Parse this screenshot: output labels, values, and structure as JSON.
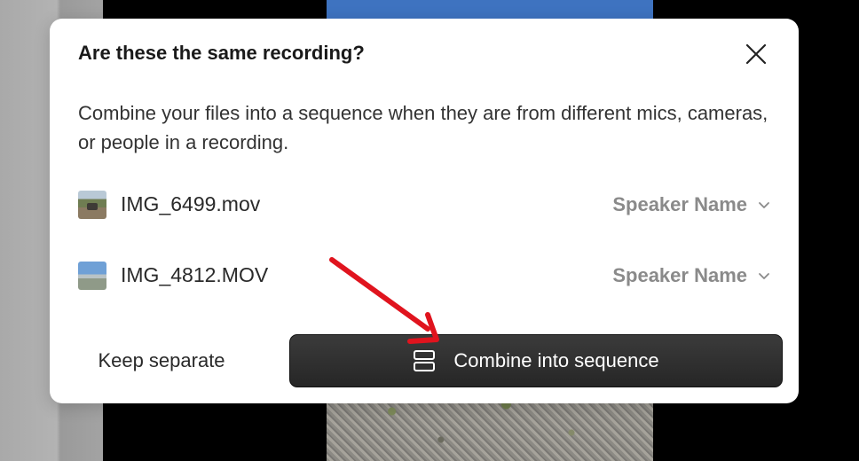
{
  "dialog": {
    "title": "Are these the same recording?",
    "description": "Combine your files into a sequence when they are from different mics, cameras, or people in a recording.",
    "files": [
      {
        "name": "IMG_6499.mov",
        "speaker": "Speaker Name"
      },
      {
        "name": "IMG_4812.MOV",
        "speaker": "Speaker Name"
      }
    ],
    "keep_separate_label": "Keep separate",
    "combine_label": "Combine into sequence"
  },
  "icons": {
    "close": "close-icon",
    "chevron": "chevron-down-icon",
    "sequence": "sequence-icon",
    "arrow": "annotation-arrow"
  },
  "colors": {
    "primary_button": "#2b2b2b",
    "annotation_arrow": "#e0141e"
  }
}
